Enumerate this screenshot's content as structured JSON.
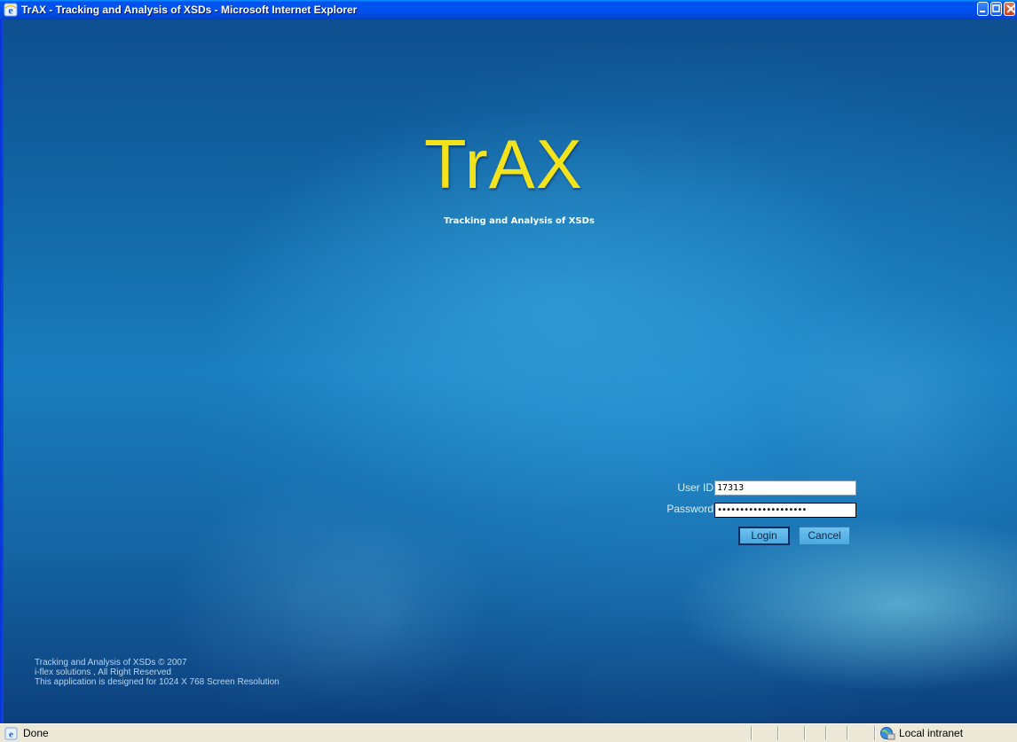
{
  "window": {
    "title": "TrAX - Tracking and Analysis of XSDs - Microsoft Internet Explorer",
    "app_icon": "ie-icon",
    "controls": [
      "minimize-icon",
      "maximize-icon",
      "close-icon"
    ]
  },
  "page": {
    "logo_text": "TrAX",
    "logo_subtitle": "Tracking and Analysis of XSDs",
    "colors": {
      "logo": "#f2e31c",
      "background": "#1a7dbd"
    }
  },
  "login": {
    "userid_label": "User ID",
    "userid_value": "17313",
    "password_label": "Password",
    "password_value": "••••••••••••••••••••",
    "login_label": "Login",
    "cancel_label": "Cancel"
  },
  "footer": {
    "line1": "Tracking and Analysis of XSDs © 2007",
    "line2": "i-flex solutions , All Right Reserved",
    "line3": "This application is designed for 1024 X 768 Screen Resolution"
  },
  "statusbar": {
    "status_text": "Done",
    "zone_text": "Local intranet",
    "status_icon": "ie-page-icon",
    "zone_icon": "local-intranet-icon"
  }
}
